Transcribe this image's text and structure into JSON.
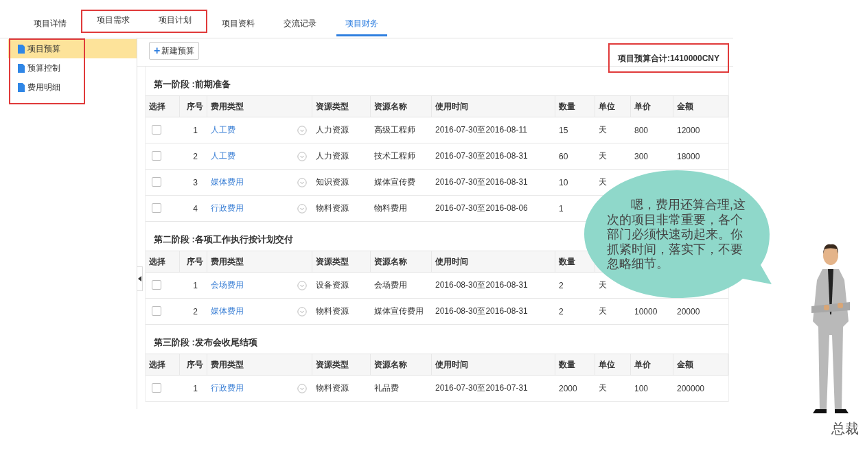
{
  "tabs": [
    {
      "label": "项目详情",
      "selected": false,
      "boxed": false
    },
    {
      "label": "项目需求",
      "selected": false,
      "boxed": true
    },
    {
      "label": "项目计划",
      "selected": false,
      "boxed": true
    },
    {
      "label": "项目资料",
      "selected": false,
      "boxed": false
    },
    {
      "label": "交流记录",
      "selected": false,
      "boxed": false
    },
    {
      "label": "项目财务",
      "selected": true,
      "boxed": false
    }
  ],
  "sidebar": {
    "boxed": true,
    "items": [
      {
        "label": "项目预算",
        "selected": true
      },
      {
        "label": "预算控制",
        "selected": false
      },
      {
        "label": "费用明细",
        "selected": false
      }
    ]
  },
  "toolbar": {
    "new_button": {
      "icon": "+",
      "label": "新建预算"
    },
    "total": {
      "text": "项目预算合计:1410000CNY",
      "boxed": true
    }
  },
  "stages": [
    {
      "title": "第一阶段 :前期准备",
      "columns": [
        "选择",
        "序号",
        "费用类型",
        "资源类型",
        "资源名称",
        "使用时间",
        "数量",
        "单位",
        "单价",
        "金额"
      ],
      "rows": [
        {
          "checked": false,
          "no": "1",
          "fee_type": "人工费",
          "resource_type": "人力资源",
          "resource_name": "高级工程师",
          "period": "2016-07-30至2016-08-11",
          "quantity": "15",
          "unit": "天",
          "unit_price": "800",
          "amount": "12000"
        },
        {
          "checked": false,
          "no": "2",
          "fee_type": "人工费",
          "resource_type": "人力资源",
          "resource_name": "技术工程师",
          "period": "2016-07-30至2016-08-31",
          "quantity": "60",
          "unit": "天",
          "unit_price": "300",
          "amount": "18000"
        },
        {
          "checked": false,
          "no": "3",
          "fee_type": "媒体费用",
          "resource_type": "知识资源",
          "resource_name": "媒体宣传费",
          "period": "2016-07-30至2016-08-31",
          "quantity": "10",
          "unit": "天"
        },
        {
          "checked": false,
          "no": "4",
          "fee_type": "行政费用",
          "resource_type": "物料资源",
          "resource_name": "物料费用",
          "period": "2016-07-30至2016-08-06",
          "quantity": "1"
        }
      ]
    },
    {
      "title": "第二阶段 :各项工作执行按计划交付",
      "columns": [
        "选择",
        "序号",
        "费用类型",
        "资源类型",
        "资源名称",
        "使用时间",
        "数量"
      ],
      "rows": [
        {
          "checked": false,
          "no": "1",
          "fee_type": "会场费用",
          "resource_type": "设备资源",
          "resource_name": "会场费用",
          "period": "2016-08-30至2016-08-31",
          "quantity": "2",
          "unit": "天"
        },
        {
          "checked": false,
          "no": "2",
          "fee_type": "媒体费用",
          "resource_type": "物料资源",
          "resource_name": "媒体宣传费用",
          "period": "2016-08-30至2016-08-31",
          "quantity": "2",
          "unit": "天",
          "unit_price": "10000",
          "amount": "20000"
        }
      ]
    },
    {
      "title": "第三阶段 :发布会收尾结项",
      "columns": [
        "选择",
        "序号",
        "费用类型",
        "资源类型",
        "资源名称",
        "使用时间",
        "数量",
        "单位",
        "单价",
        "金额"
      ],
      "rows": [
        {
          "checked": false,
          "no": "1",
          "fee_type": "行政费用",
          "resource_type": "物料资源",
          "resource_name": "礼品费",
          "period": "2016-07-30至2016-07-31",
          "quantity": "2000",
          "unit": "天",
          "unit_price": "100",
          "amount": "200000"
        }
      ]
    }
  ],
  "speech_bubble": {
    "text": "嗯，费用还算合理,这次的项目非常重要，各个部门必须快速动起来。你抓紧时间，落实下，不要忽略细节。"
  },
  "character": {
    "caption": "总裁"
  }
}
